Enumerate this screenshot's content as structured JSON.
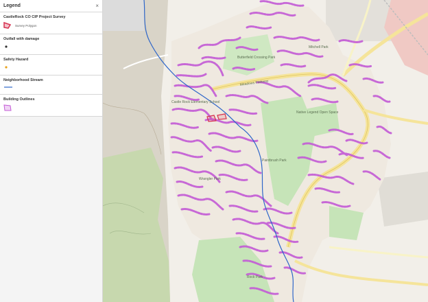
{
  "legend": {
    "title": "Legend",
    "close": "×",
    "sections": [
      {
        "title": "CastleRock CO CIP Project Survey",
        "items": [
          {
            "label": "Survey Polygon",
            "symbol": "polygon-red"
          }
        ]
      },
      {
        "title": "Outfall with damage",
        "items": [
          {
            "label": "",
            "symbol": "dot-dark"
          }
        ]
      },
      {
        "title": "Safety Hazard",
        "items": [
          {
            "label": "",
            "symbol": "dot-orange"
          }
        ]
      },
      {
        "title": "Neighborhood Stream",
        "items": [
          {
            "label": "",
            "symbol": "line-blue"
          }
        ]
      },
      {
        "title": "Building Outlines",
        "items": [
          {
            "label": "",
            "symbol": "polygon-purple"
          }
        ]
      }
    ]
  },
  "map": {
    "colors": {
      "buildings": "#c35bd6",
      "stream": "#2e66c9",
      "survey": "#d6314f",
      "park": "#c6e4b8",
      "road": "#f5e49a",
      "base": "#f2efe9"
    },
    "labels": [
      {
        "text": "Meadows Parkway"
      },
      {
        "text": "Butterfield Crossing Park"
      },
      {
        "text": "Mitchell Park"
      },
      {
        "text": "Paintbrush Park"
      },
      {
        "text": "Wrangler Park"
      },
      {
        "text": "Castle Rock Elementary School"
      },
      {
        "text": "Rock Park"
      },
      {
        "text": "Native Legend Open Space"
      }
    ]
  }
}
